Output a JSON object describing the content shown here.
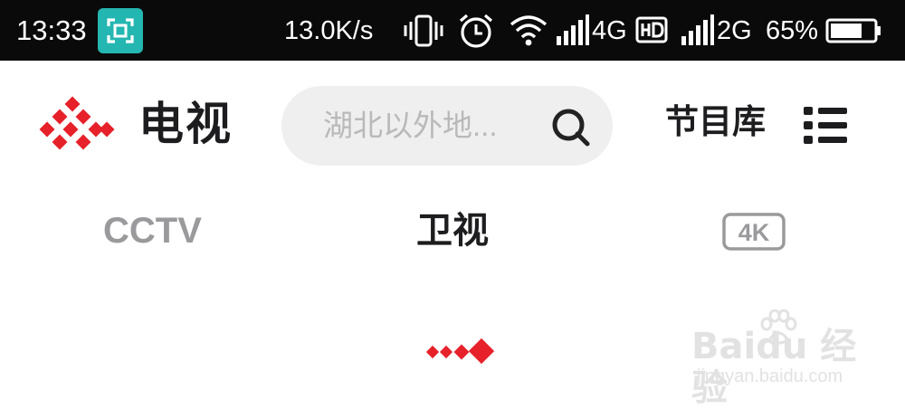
{
  "status_bar": {
    "time": "13:33",
    "network_speed": "13.0K/s",
    "network_1": "4G",
    "network_2": "2G",
    "battery": "65%",
    "icons": [
      "screenshot-icon",
      "vibrate-icon",
      "alarm-icon",
      "wifi-icon",
      "signal-icon",
      "hd-icon",
      "battery-icon"
    ]
  },
  "header": {
    "title": "电视",
    "search_placeholder": "湖北以外地...",
    "library_label": "节目库"
  },
  "tabs": [
    {
      "label": "CCTV",
      "active": false
    },
    {
      "label": "卫视",
      "active": true
    },
    {
      "label": "4K",
      "active": false
    }
  ],
  "watermark": {
    "brand": "Baidu 经验",
    "url": "jingyan.baidu.com"
  },
  "colors": {
    "accent": "#e6212a",
    "status_bar_bg": "#0a0a0a",
    "search_bg": "#efefef",
    "inactive_tab": "#9a9a9c",
    "active_tab": "#1d1d1f",
    "screenshot_badge": "#24b6b1"
  }
}
